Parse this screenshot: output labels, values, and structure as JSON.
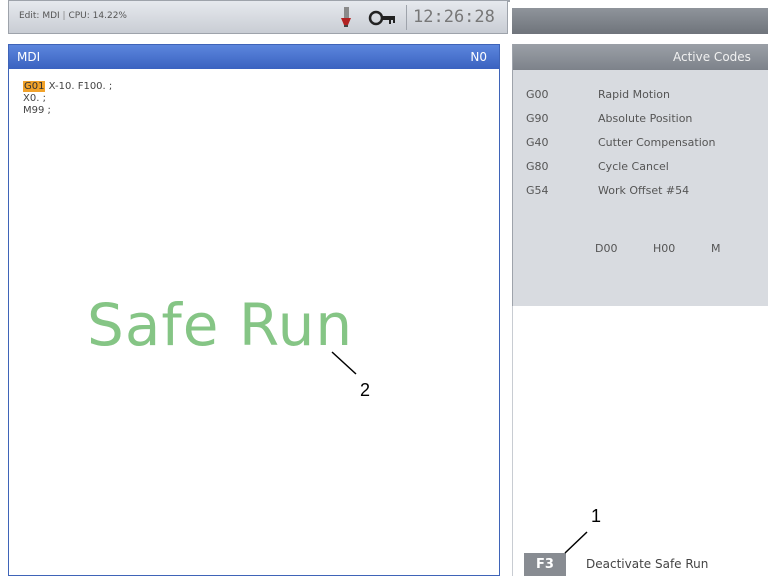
{
  "status_bar": {
    "mode": "Edit: MDI",
    "separator": "|",
    "cpu": "CPU: 14.22%",
    "clock": "12:26:28",
    "tool_icon": "tool-change-icon",
    "key_icon": "key-icon"
  },
  "mdi": {
    "title": "MDI",
    "line_number": "N0",
    "code_lines": [
      {
        "highlight": "G01",
        "rest": " X-10. F100. ;"
      },
      {
        "highlight": "",
        "rest": "X0. ;"
      },
      {
        "highlight": "",
        "rest": "M99 ;"
      }
    ],
    "overlay": "Safe Run"
  },
  "active_codes": {
    "title": "Active Codes",
    "rows": [
      {
        "code": "G00",
        "desc": "Rapid Motion"
      },
      {
        "code": "G90",
        "desc": "Absolute Position"
      },
      {
        "code": "G40",
        "desc": "Cutter Compensation"
      },
      {
        "code": "G80",
        "desc": "Cycle Cancel"
      },
      {
        "code": "G54",
        "desc": "Work Offset #54"
      }
    ],
    "d_code": "D00",
    "h_code": "H00",
    "extra": "M"
  },
  "hint": {
    "key": "F3",
    "label": "Deactivate Safe Run"
  },
  "callouts": {
    "one": "1",
    "two": "2"
  },
  "colors": {
    "accent_blue": "#3a62c0",
    "highlight_orange": "#f1a22a",
    "safe_run_green": "#7fc27f"
  }
}
